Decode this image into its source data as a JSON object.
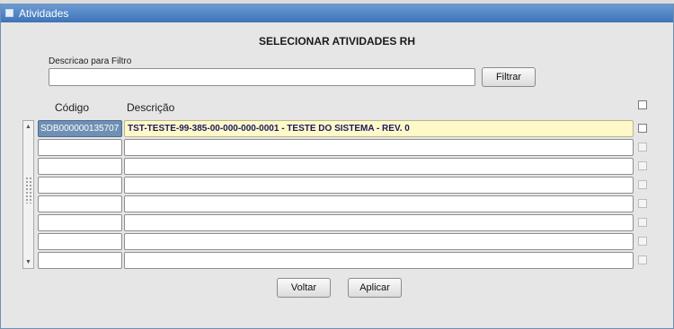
{
  "window": {
    "title": "Atividades"
  },
  "heading": "SELECIONAR ATIVIDADES RH",
  "filter": {
    "label": "Descricao para Filtro",
    "value": "",
    "button": "Filtrar"
  },
  "table": {
    "columns": [
      "Código",
      "Descrição"
    ],
    "rows": [
      {
        "code": "SDB000000135707",
        "description": "TST-TESTE-99-385-00-000-000-0001 - TESTE DO SISTEMA - REV. 0",
        "selected": true
      },
      {
        "code": "",
        "description": "",
        "selected": false
      },
      {
        "code": "",
        "description": "",
        "selected": false
      },
      {
        "code": "",
        "description": "",
        "selected": false
      },
      {
        "code": "",
        "description": "",
        "selected": false
      },
      {
        "code": "",
        "description": "",
        "selected": false
      },
      {
        "code": "",
        "description": "",
        "selected": false
      },
      {
        "code": "",
        "description": "",
        "selected": false
      }
    ]
  },
  "actions": {
    "back": "Voltar",
    "apply": "Aplicar"
  },
  "colors": {
    "titlebar": "#3e73b8",
    "selected_code_bg": "#6f8fb3",
    "selected_desc_bg": "#fff8c8"
  }
}
